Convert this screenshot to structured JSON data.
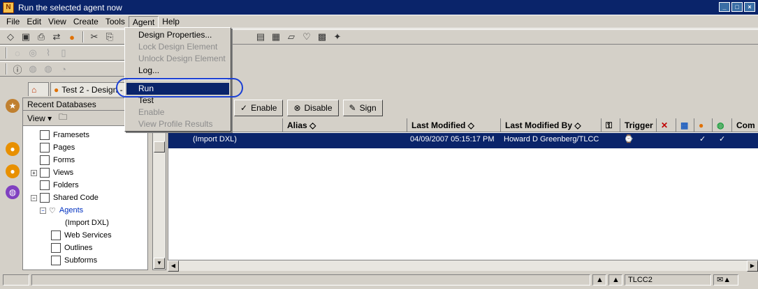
{
  "window": {
    "title": "Run the selected agent now",
    "app_icon": "lotus-notes-icon"
  },
  "menubar": [
    "File",
    "Edit",
    "View",
    "Create",
    "Tools",
    "Agent",
    "Help"
  ],
  "agent_menu": {
    "items": [
      {
        "label": "Design Properties...",
        "enabled": true
      },
      {
        "label": "Lock Design Element",
        "enabled": false
      },
      {
        "label": "Unlock Design Element",
        "enabled": false
      },
      {
        "label": "Log...",
        "enabled": true
      },
      {
        "label": "Run",
        "enabled": true,
        "selected": true
      },
      {
        "label": "Test",
        "enabled": true
      },
      {
        "label": "Enable",
        "enabled": false
      },
      {
        "label": "View Profile Results",
        "enabled": false
      }
    ]
  },
  "tabs": [
    {
      "label": "Test 2 - Design - /"
    }
  ],
  "nav": {
    "header": "Recent Databases",
    "view_label": "View",
    "tree": [
      "Framesets",
      "Pages",
      "Forms",
      "Views",
      "Folders",
      "Shared Code",
      "Agents",
      "(Import DXL)",
      "Web Services",
      "Outlines",
      "Subforms"
    ]
  },
  "actions": {
    "enable": "Enable",
    "disable": "Disable",
    "sign": "Sign"
  },
  "grid": {
    "columns": [
      "Alias",
      "Last Modified",
      "Last Modified By",
      "Trigger",
      "Com"
    ],
    "row": {
      "name": "(Import DXL)",
      "modified": "04/09/2007 05:15:17 PM",
      "modified_by": "Howard D Greenberg/TLCC"
    }
  },
  "status": {
    "server": "TLCC2"
  }
}
